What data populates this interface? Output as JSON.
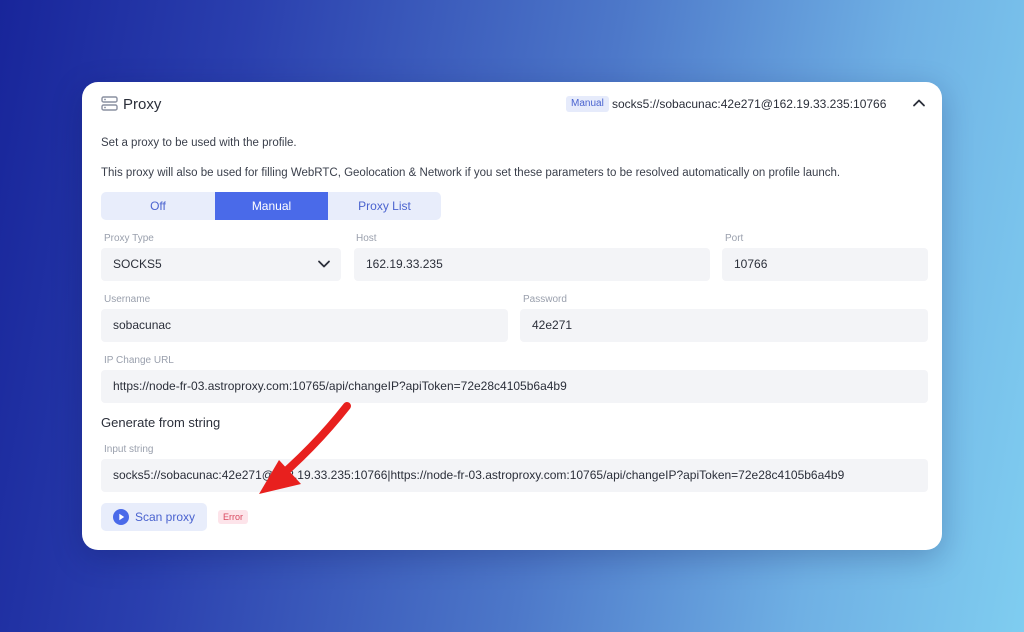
{
  "header": {
    "title": "Proxy",
    "mode_badge": "Manual",
    "proxy_summary": "socks5://sobacunac:42e271@162.19.33.235:10766"
  },
  "description": {
    "line1": "Set a proxy to be used with the profile.",
    "line2": "This proxy will also be used for filling WebRTC, Geolocation & Network if you set these parameters to be resolved automatically on profile launch."
  },
  "mode_tabs": [
    {
      "label": "Off",
      "active": false
    },
    {
      "label": "Manual",
      "active": true
    },
    {
      "label": "Proxy List",
      "active": false
    }
  ],
  "fields": {
    "proxy_type": {
      "label": "Proxy Type",
      "value": "SOCKS5"
    },
    "host": {
      "label": "Host",
      "value": "162.19.33.235"
    },
    "port": {
      "label": "Port",
      "value": "10766"
    },
    "username": {
      "label": "Username",
      "value": "sobacunac"
    },
    "password": {
      "label": "Password",
      "value": "42e271"
    },
    "ip_change_url": {
      "label": "IP Change URL",
      "value": "https://node-fr-03.astroproxy.com:10765/api/changeIP?apiToken=72e28c4105b6a4b9"
    }
  },
  "generate": {
    "title": "Generate from string",
    "input_label": "Input string",
    "input_value": "socks5://sobacunac:42e271@162.19.33.235:10766|https://node-fr-03.astroproxy.com:10765/api/changeIP?apiToken=72e28c4105b6a4b9"
  },
  "scan": {
    "button_label": "Scan proxy",
    "status": "Error"
  },
  "colors": {
    "accent": "#4a6ae9",
    "annotation_arrow": "#e8201e",
    "error": "#d9485f"
  }
}
